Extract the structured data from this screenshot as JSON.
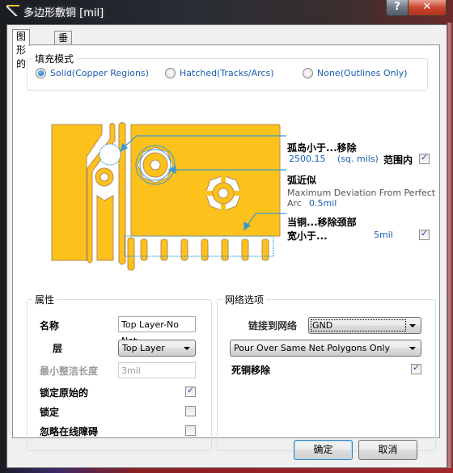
{
  "window": {
    "title": "多边形敷铜 [mil]",
    "help_label": "?",
    "close_label": "✕"
  },
  "tabs": [
    {
      "label": "图形的",
      "active": true
    },
    {
      "label": "垂直外框",
      "active": false
    }
  ],
  "fill_mode": {
    "label": "填充模式",
    "options": [
      {
        "label": "Solid(Copper Regions)",
        "selected": true
      },
      {
        "label": "Hatched(Tracks/Arcs)",
        "selected": false
      },
      {
        "label": "None(Outlines Only)",
        "selected": false
      }
    ]
  },
  "diagram_options": {
    "island": {
      "title": "孤岛小于...移除",
      "value": "2500.15",
      "unit": "(sq. mils)",
      "checkbox_label": "范围内",
      "checked": true
    },
    "arc": {
      "title": "弧近似",
      "desc_line1": "Maximum Deviation From Perfect",
      "desc_line2": "Arc",
      "value": "0.5mil"
    },
    "neck": {
      "title": "当铜...移除颈部",
      "label": "宽小于...",
      "value": "5mil",
      "checked": true
    }
  },
  "properties": {
    "label": "属性",
    "name_label": "名称",
    "name_value": "Top Layer-No Net",
    "layer_label": "层",
    "layer_value": "Top Layer",
    "min_length_label": "最小整洁长度",
    "min_length_value": "3mil",
    "lock_primitives_label": "锁定原始的",
    "lock_primitives_checked": true,
    "locked_label": "锁定",
    "locked_checked": false,
    "ignore_obstacles_label": "忽略在线障碍",
    "ignore_obstacles_checked": false
  },
  "net_options": {
    "label": "网络选项",
    "connect_label": "链接到网络",
    "connect_value": "GND",
    "pour_value": "Pour Over Same Net Polygons Only",
    "remove_dead_label": "死铜移除",
    "remove_dead_checked": true
  },
  "buttons": {
    "ok": "确定",
    "cancel": "取消"
  },
  "colors": {
    "copper": "#fcc21b",
    "copper_outline": "#b8875a",
    "annotation": "#3a9ad0",
    "link_text": "#1a5fb4"
  }
}
